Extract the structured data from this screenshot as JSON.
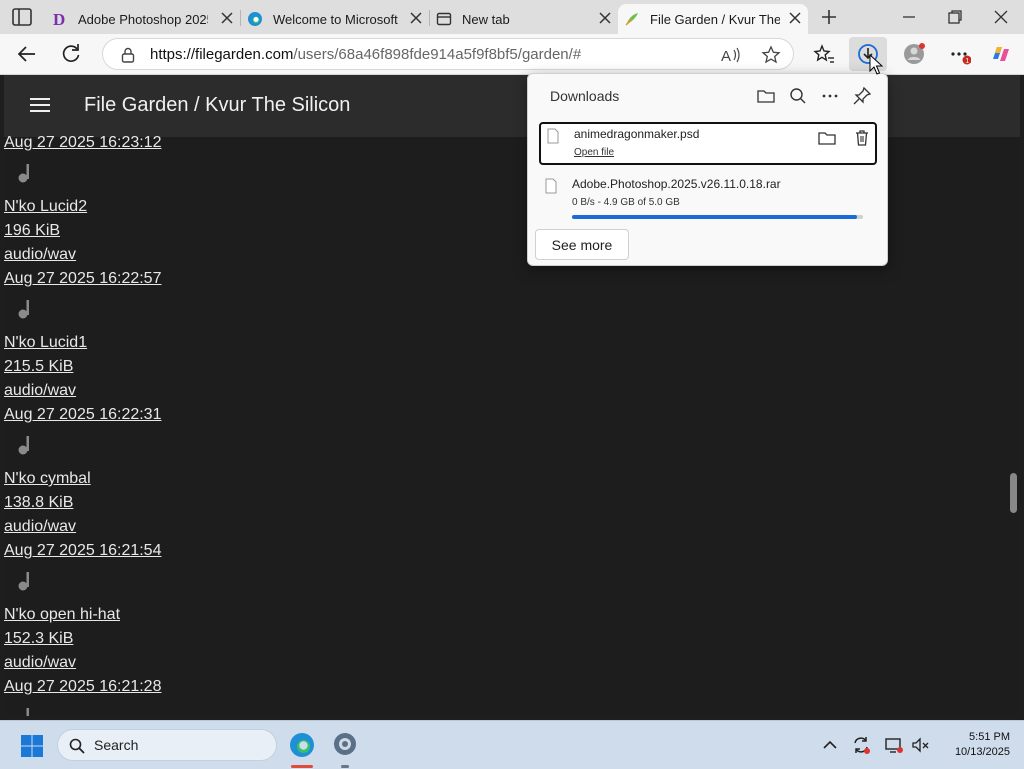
{
  "browser": {
    "tabs": [
      {
        "title": "Adobe Photoshop 2025",
        "favicon": "d-letter-icon",
        "active": false
      },
      {
        "title": "Welcome to Microsoft E",
        "favicon": "edge-icon",
        "active": false
      },
      {
        "title": "New tab",
        "favicon": "new-tab-icon",
        "active": false
      },
      {
        "title": "File Garden / Kvur The S",
        "favicon": "file-garden-icon",
        "active": true
      }
    ],
    "url_host": "https://filegarden.com",
    "url_path": "/users/68a46f898fde914a5f9f8bf5/garden/#"
  },
  "page": {
    "title": "File Garden / Kvur The Silicon",
    "top_partial": "Aug 27 2025 16:23:12",
    "files": [
      {
        "name": "N'ko Lucid2",
        "size": "196 KiB",
        "type": "audio/wav",
        "date": "Aug 27 2025 16:22:57"
      },
      {
        "name": "N'ko Lucid1",
        "size": "215.5 KiB",
        "type": "audio/wav",
        "date": "Aug 27 2025 16:22:31"
      },
      {
        "name": "N'ko cymbal",
        "size": "138.8 KiB",
        "type": "audio/wav",
        "date": "Aug 27 2025 16:21:54"
      },
      {
        "name": "N'ko open hi-hat",
        "size": "152.3 KiB",
        "type": "audio/wav",
        "date": "Aug 27 2025 16:21:28"
      }
    ]
  },
  "downloads": {
    "title": "Downloads",
    "items": [
      {
        "name": "animedragonmaker.psd",
        "action": "Open file"
      },
      {
        "name": "Adobe.Photoshop.2025.v26.11.0.18.rar",
        "status": "0 B/s - 4.9 GB of 5.0 GB",
        "progress": 0.98
      }
    ],
    "see_more": "See more"
  },
  "taskbar": {
    "search_label": "Search",
    "time": "5:51 PM",
    "date": "10/13/2025"
  },
  "colors": {
    "accent": "#1a6ad8",
    "page_bg": "#1d1d1d",
    "header_bg": "#2c2c2c"
  }
}
